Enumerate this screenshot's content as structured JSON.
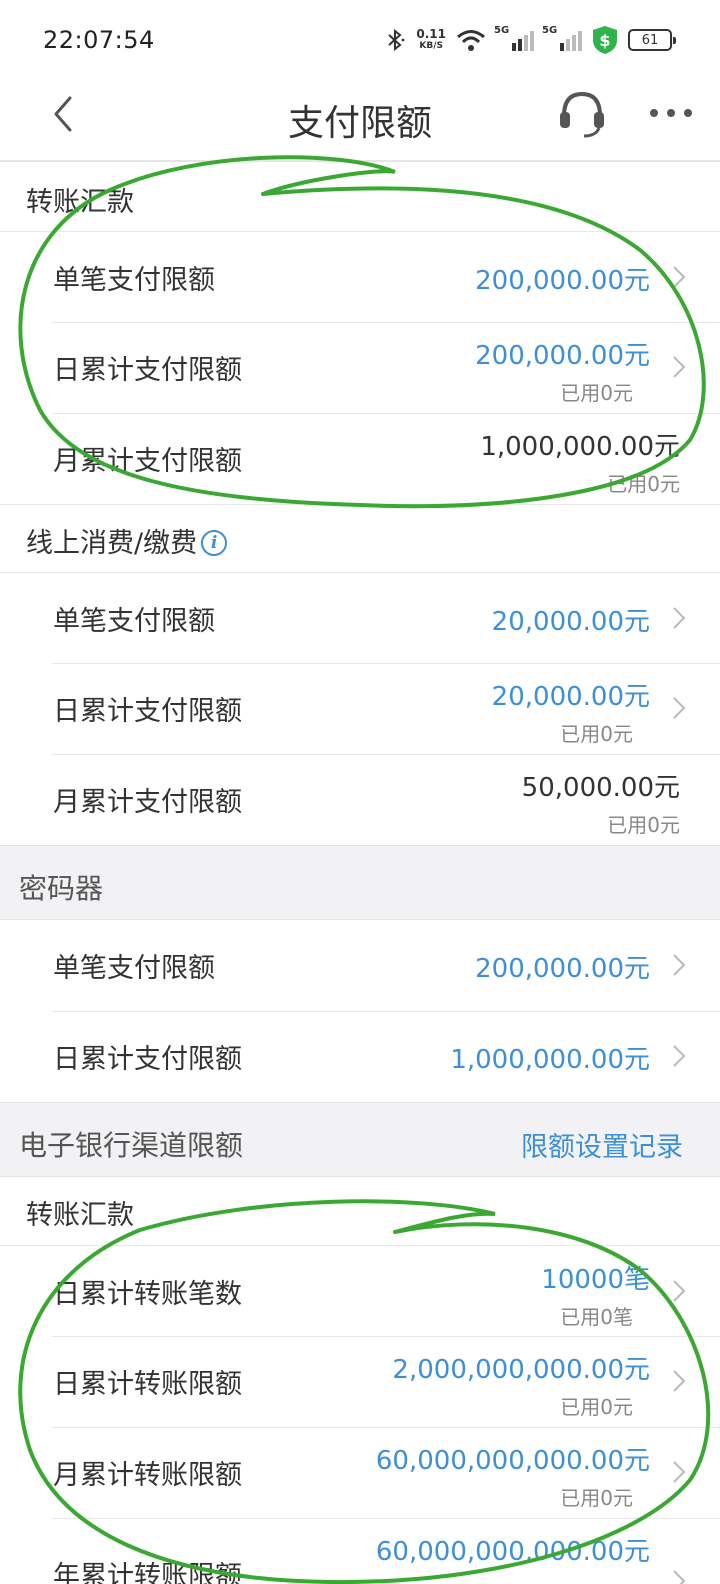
{
  "status": {
    "time": "22:07:54",
    "net_speed": "0.11",
    "net_unit": "KB/S",
    "sig1": "5G",
    "sig2": "5G",
    "battery": "61"
  },
  "nav": {
    "title": "支付限额"
  },
  "sections": {
    "transfer": {
      "title": "转账汇款",
      "single": {
        "label": "单笔支付限额",
        "value": "200,000.00元"
      },
      "daily": {
        "label": "日累计支付限额",
        "value": "200,000.00元",
        "used": "已用0元"
      },
      "monthly": {
        "label": "月累计支付限额",
        "value": "1,000,000.00元",
        "used": "已用0元"
      }
    },
    "online": {
      "title": "线上消费/缴费",
      "single": {
        "label": "单笔支付限额",
        "value": "20,000.00元"
      },
      "daily": {
        "label": "日累计支付限额",
        "value": "20,000.00元",
        "used": "已用0元"
      },
      "monthly": {
        "label": "月累计支付限额",
        "value": "50,000.00元",
        "used": "已用0元"
      }
    },
    "token": {
      "title": "密码器",
      "single": {
        "label": "单笔支付限额",
        "value": "200,000.00元"
      },
      "daily": {
        "label": "日累计支付限额",
        "value": "1,000,000.00元"
      }
    },
    "ebank": {
      "title": "电子银行渠道限额",
      "link": "限额设置记录",
      "sub_title": "转账汇款",
      "daily_count": {
        "label": "日累计转账笔数",
        "value": "10000笔",
        "used": "已用0笔"
      },
      "daily_amount": {
        "label": "日累计转账限额",
        "value": "2,000,000,000.00元",
        "used": "已用0元"
      },
      "monthly_amount": {
        "label": "月累计转账限额",
        "value": "60,000,000,000.00元",
        "used": "已用0元"
      },
      "yearly_amount": {
        "label": "年累计转账限额",
        "value": "60,000,000,000.00元"
      }
    }
  },
  "colors": {
    "accent": "#3d8fd8",
    "annotation": "#3aa832",
    "shield": "#2fb34a"
  }
}
